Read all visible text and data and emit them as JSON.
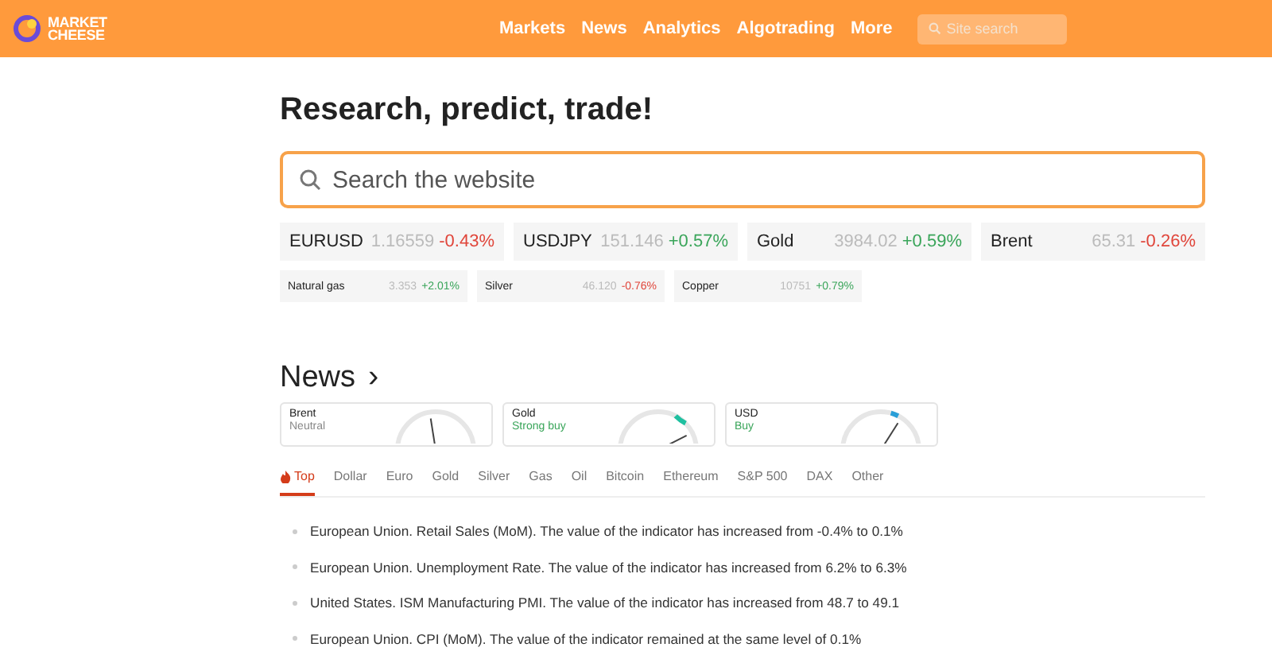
{
  "header": {
    "logo": [
      "MARKET",
      "CHEESE"
    ],
    "nav": [
      "Markets",
      "News",
      "Analytics",
      "Algotrading",
      "More"
    ],
    "search": {
      "placeholder": "Site search"
    }
  },
  "headline": "Research, predict, trade!",
  "search": {
    "placeholder": "Search the website"
  },
  "quotes": [
    {
      "name": "EURUSD",
      "price": "1.16559",
      "change": "-0.43%",
      "color": "#e0453a"
    },
    {
      "name": "USDJPY",
      "price": "151.146",
      "change": "+0.57%",
      "color": "#3aa55a"
    },
    {
      "name": "Gold",
      "price": "3984.02",
      "change": "+0.59%",
      "color": "#3aa55a"
    },
    {
      "name": "Brent",
      "price": "65.31",
      "change": "-0.26%",
      "color": "#e0453a"
    }
  ],
  "small_quotes": [
    {
      "name": "Natural gas",
      "price": "3.353",
      "change": "+2.01%",
      "color": "#3aa55a"
    },
    {
      "name": "Silver",
      "price": "46.120",
      "change": "-0.76%",
      "color": "#e0453a"
    },
    {
      "name": "Copper",
      "price": "10751",
      "change": "+0.79%",
      "color": "#3aa55a"
    }
  ],
  "news": {
    "title": "News",
    "arrow": "›"
  },
  "signals": [
    {
      "asset": "Brent",
      "signal": "Neutral",
      "kind": "neutral",
      "level": 0.45
    },
    {
      "asset": "Gold",
      "signal": "Strong buy",
      "kind": "strong_buy",
      "level": 0.85
    },
    {
      "asset": "USD",
      "signal": "Buy",
      "kind": "buy",
      "level": 0.68
    }
  ],
  "tabs": [
    {
      "label": "Top",
      "selected": true
    },
    {
      "label": "Dollar",
      "selected": false
    },
    {
      "label": "Euro",
      "selected": false
    },
    {
      "label": "Gold",
      "selected": false
    },
    {
      "label": "Silver",
      "selected": false
    },
    {
      "label": "Gas",
      "selected": false
    },
    {
      "label": "Oil",
      "selected": false
    },
    {
      "label": "Bitcoin",
      "selected": false
    },
    {
      "label": "Ethereum",
      "selected": false
    },
    {
      "label": "S&P 500",
      "selected": false
    },
    {
      "label": "DAX",
      "selected": false
    },
    {
      "label": "Other",
      "selected": false
    }
  ],
  "articles": [
    "European Union. Retail Sales (MoM). The value of the indicator has increased from -0.4% to 0.1%",
    "European Union. Unemployment Rate. The value of the indicator has increased from 6.2% to 6.3%",
    "United States. ISM Manufacturing PMI. The value of the indicator has increased from 48.7 to 49.1",
    "European Union. CPI (MoM). The value of the indicator remained at the same level of 0.1%"
  ]
}
